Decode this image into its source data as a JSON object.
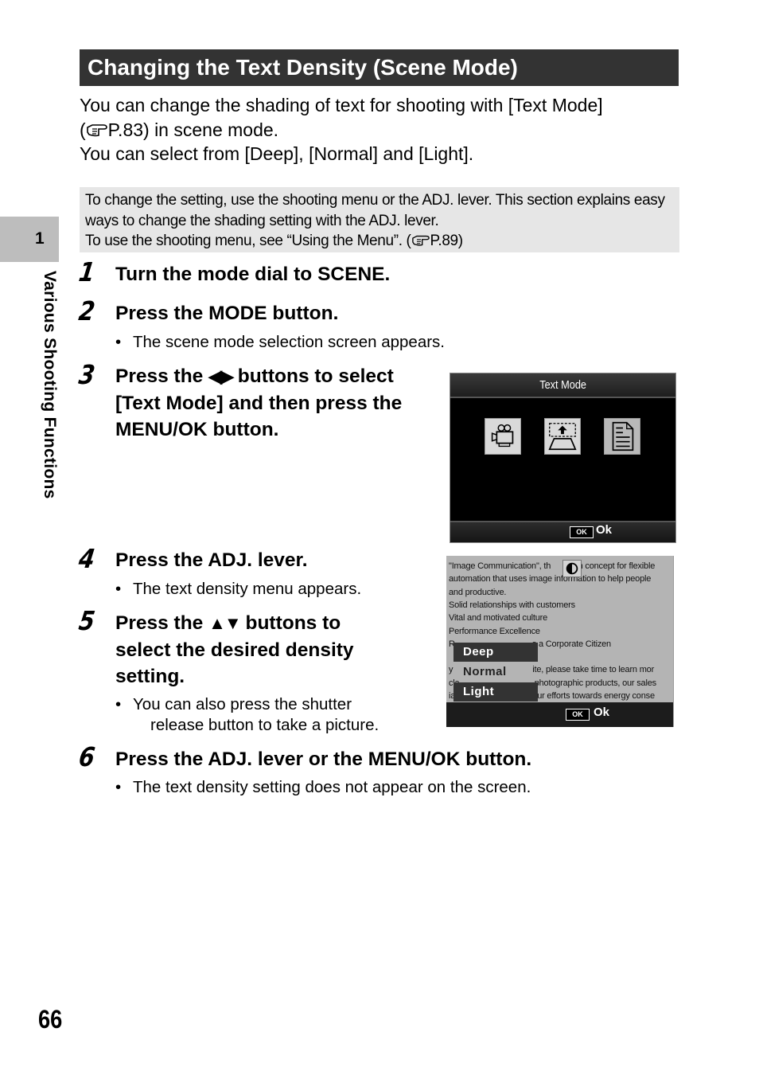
{
  "chapter": {
    "number": "1",
    "title": "Various Shooting Functions"
  },
  "section": {
    "title": "Changing the Text Density (Scene Mode)"
  },
  "intro": {
    "line1": "You can change the shading of text for shooting with [Text Mode]",
    "line2_pre": "(",
    "line2_ref": "P.83) in scene mode.",
    "line3": "You can select from [Deep], [Normal] and [Light]."
  },
  "note": {
    "line1": "To change the setting, use the shooting menu or the ADJ. lever. This section explains easy",
    "line2": "ways to change the shading setting with the ADJ. lever.",
    "line3_pre": "To use the shooting menu, see “Using the Menu”. (",
    "line3_ref": "P.89)"
  },
  "steps": [
    {
      "number": "1",
      "title": "Turn the mode dial to SCENE."
    },
    {
      "number": "2",
      "title": "Press the MODE button.",
      "bullet": "The scene mode selection screen appears."
    },
    {
      "number": "3",
      "title_pre": "Press the",
      "arrows": "◀▶",
      "title_post": " buttons to select",
      "title_line2": "[Text Mode] and then press the",
      "title_line3": "MENU/OK button."
    },
    {
      "number": "4",
      "title": "Press the ADJ. lever.",
      "bullet": "The text density menu appears."
    },
    {
      "number": "5",
      "title_pre": "Press the ",
      "arrows": "▲▼",
      "title_post": " buttons to",
      "title_line2": "select the desired density",
      "title_line3": "setting.",
      "bullet_line1": "You can also press the shutter",
      "bullet_line2": "release button to take a picture."
    },
    {
      "number": "6",
      "title": "Press the ADJ. lever or the MENU/OK button.",
      "bullet": "The text density setting does not appear on the screen."
    }
  ],
  "bullet_char": "•",
  "screen1": {
    "title": "Text Mode",
    "icons": [
      "movie-camera-icon",
      "skew-correction-icon",
      "text-document-icon"
    ],
    "selected_icon": "text-document-icon",
    "ok_badge": "OK",
    "ok_label": "Ok"
  },
  "screen2": {
    "background_lines": [
      "\"Image Communication\", th          oh concept for flexible",
      "automation that uses image information to help people",
      "and productive.",
      "Solid relationships with customers",
      "Vital and motivated culture",
      "Performance Excellence",
      "R                                  s a Corporate Citizen",
      "",
      "y                                   ite, please take time to learn mor",
      "cla                                 photographic products, our sales",
      "ia                                  our efforts towards energy conse"
    ],
    "density_options": [
      "Deep",
      "Normal",
      "Light"
    ],
    "selected_option": "Normal",
    "ok_badge": "OK",
    "ok_label": "Ok"
  },
  "page_number": "66"
}
